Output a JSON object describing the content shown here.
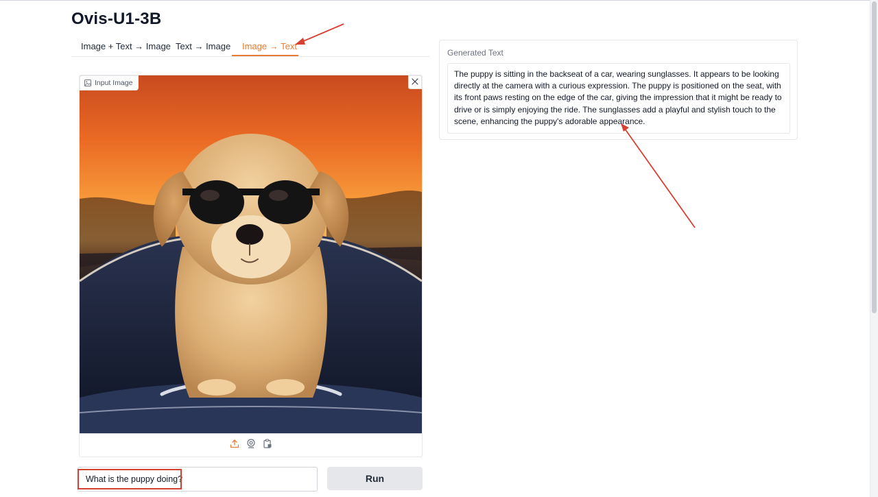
{
  "app": {
    "title": "Ovis-U1-3B"
  },
  "tabs": [
    {
      "label": "Image + Text → Image",
      "active": false
    },
    {
      "label": "Text → Image",
      "active": false
    },
    {
      "label": "Image → Text",
      "active": true
    }
  ],
  "input_image": {
    "label": "Input Image",
    "icons": [
      "image-icon",
      "close-icon",
      "upload-icon",
      "webcam-icon",
      "clipboard-icon"
    ]
  },
  "prompt": {
    "value": "What is the puppy doing?"
  },
  "run_button": {
    "label": "Run"
  },
  "output": {
    "label": "Generated Text",
    "text": "The puppy is sitting in the backseat of a car, wearing sunglasses. It appears to be looking directly at the camera with a curious expression. The puppy is positioned on the seat, with its front paws resting on the edge of the car, giving the impression that it might be ready to drive or is simply enjoying the ride. The sunglasses add a playful and stylish touch to the scene, enhancing the puppy's adorable appearance."
  },
  "colors": {
    "accent": "#ea7b34",
    "annotation": "#d64031",
    "button_bg": "#e5e7eb"
  }
}
